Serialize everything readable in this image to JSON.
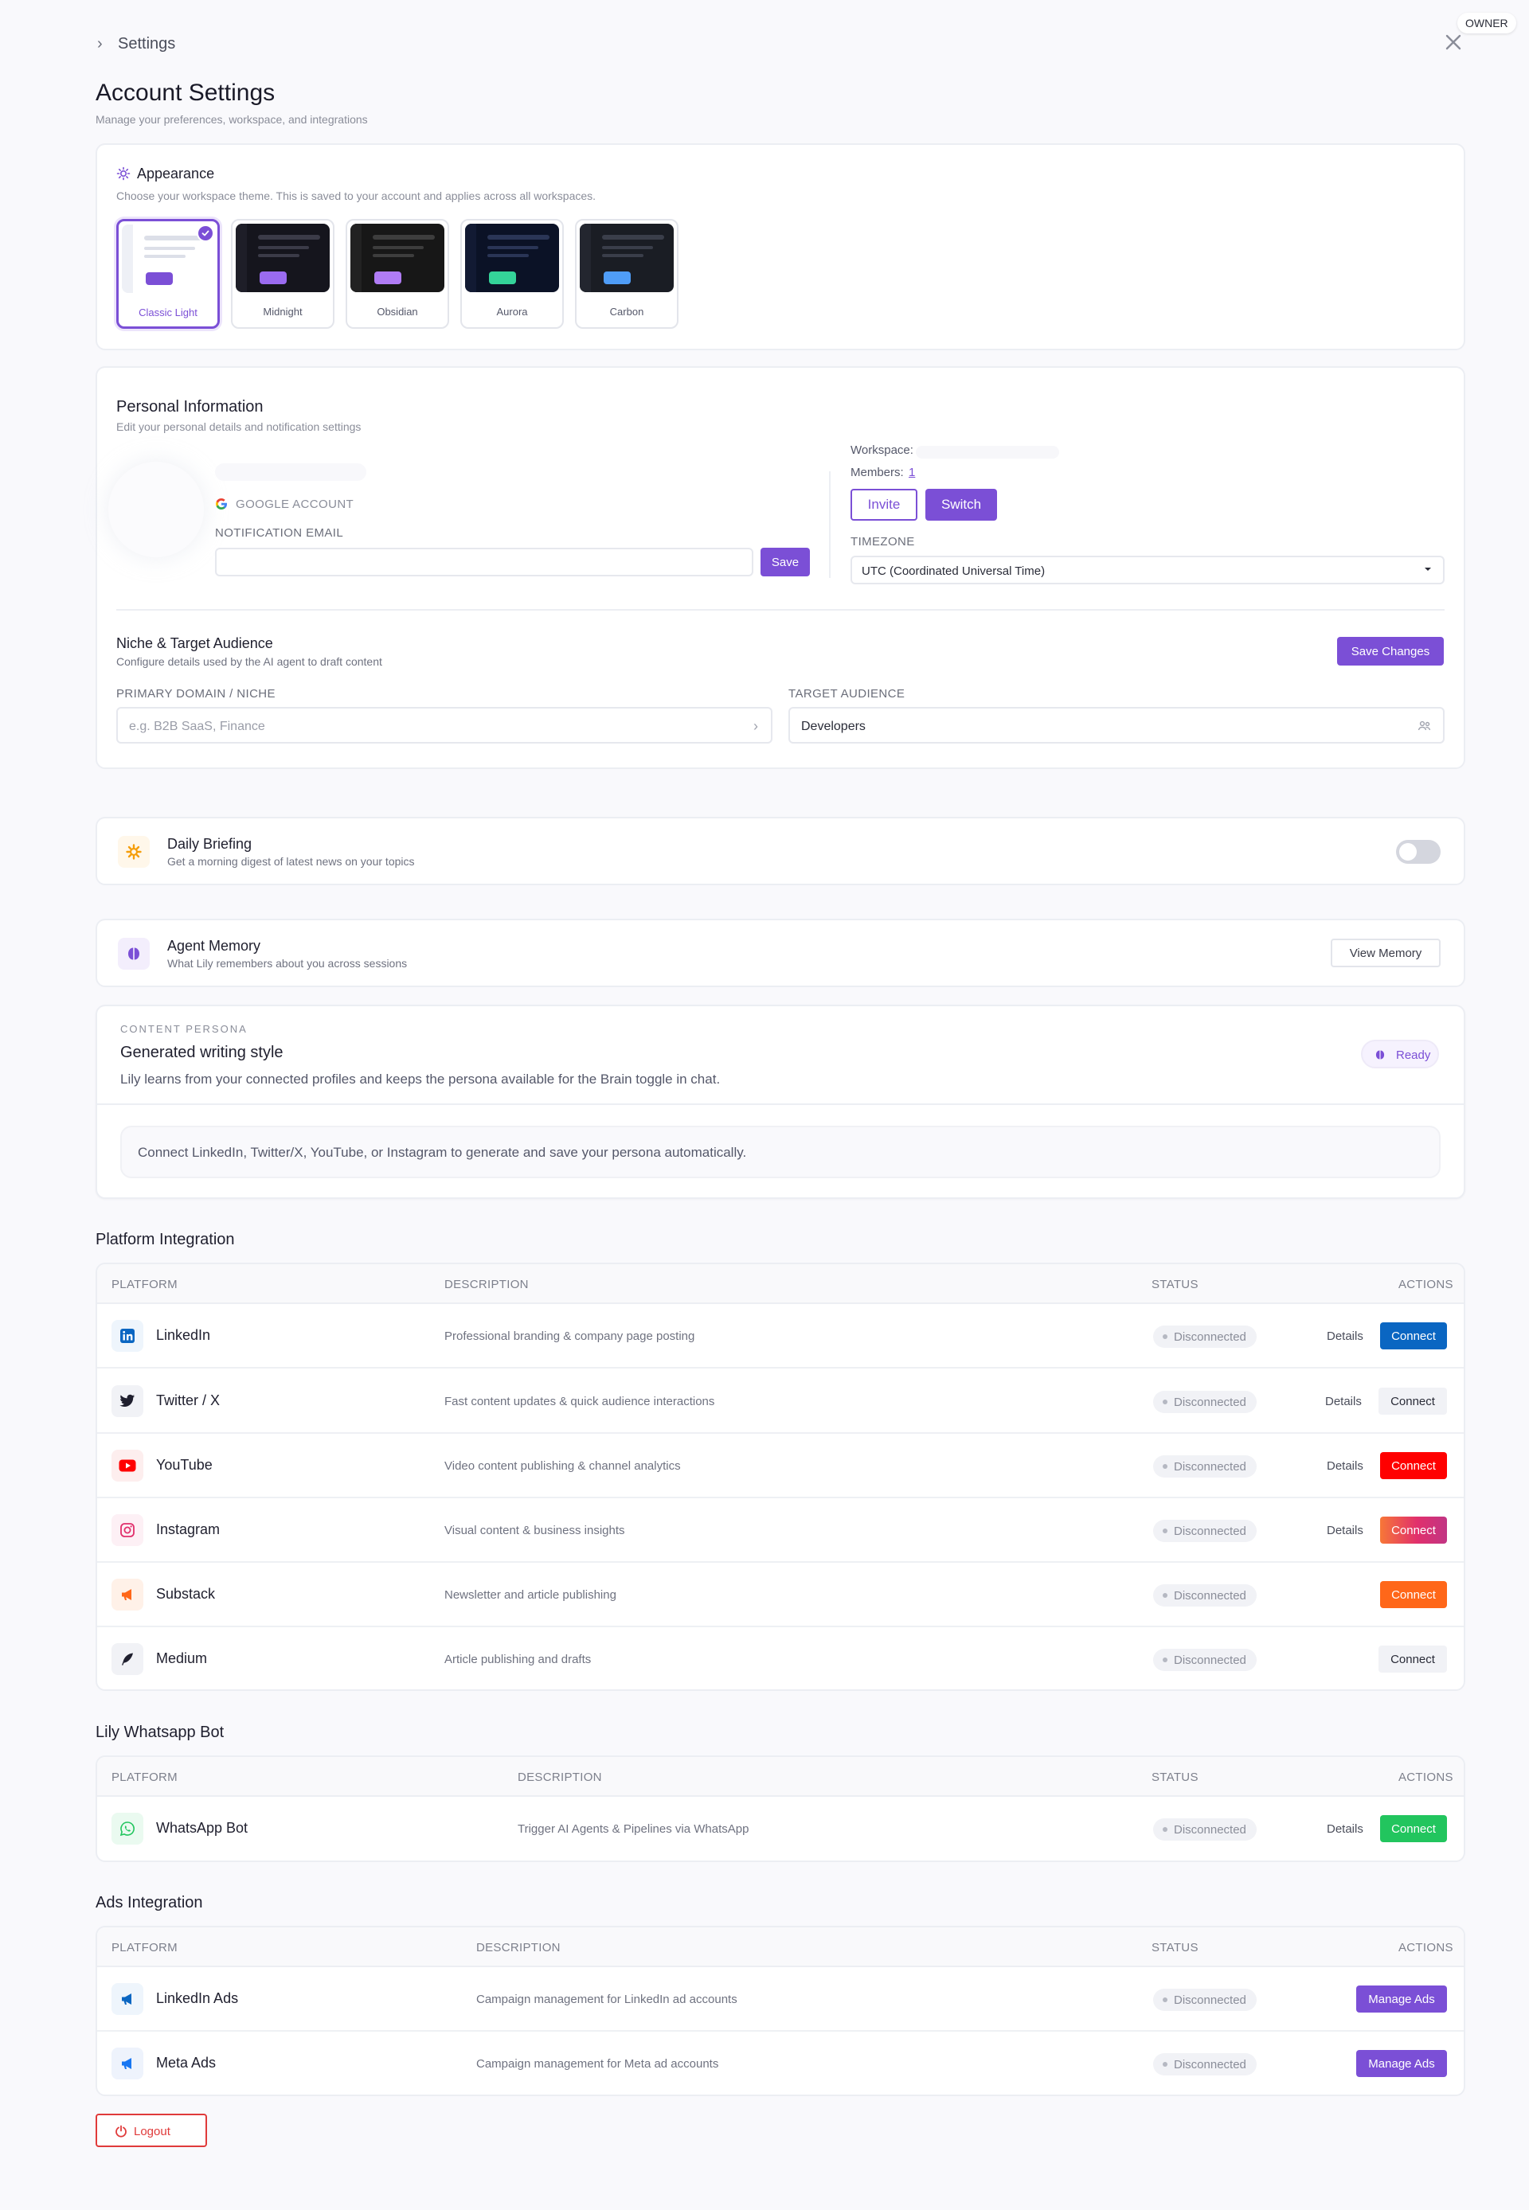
{
  "header": {
    "breadcrumb": "Settings",
    "role_badge": "OWNER",
    "title": "Account Settings",
    "subtitle": "Manage your preferences, workspace, and integrations"
  },
  "appearance": {
    "title": "Appearance",
    "description": "Choose your workspace theme. This is saved to your account and applies across all workspaces.",
    "selected": "Classic Light",
    "themes": [
      {
        "name": "Classic Light",
        "bg": "#ffffff",
        "sidebar": "#eef0f6",
        "line": "#dcdfe8",
        "chip": "#7b4fd6"
      },
      {
        "name": "Midnight",
        "bg": "#15151d",
        "sidebar": "#1e1e28",
        "line": "#3b3b48",
        "chip": "#9a6bf0"
      },
      {
        "name": "Obsidian",
        "bg": "#171717",
        "sidebar": "#222222",
        "line": "#3d3d3d",
        "chip": "#b07cf5"
      },
      {
        "name": "Aurora",
        "bg": "#0b1226",
        "sidebar": "#121a33",
        "line": "#2a3556",
        "chip": "#34d399"
      },
      {
        "name": "Carbon",
        "bg": "#1a1d24",
        "sidebar": "#23262f",
        "line": "#3a3e4a",
        "chip": "#4f9df7"
      }
    ]
  },
  "personal": {
    "title": "Personal Information",
    "subtitle": "Edit your personal details and notification settings",
    "google_account_label": "GOOGLE ACCOUNT",
    "notification_email_label": "NOTIFICATION EMAIL",
    "notification_email_value": "",
    "save_label": "Save",
    "workspace_label": "Workspace:",
    "members_label": "Members:",
    "members_count": "1",
    "invite_label": "Invite",
    "switch_label": "Switch",
    "timezone_label": "TIMEZONE",
    "timezone_value": "UTC (Coordinated Universal Time)"
  },
  "niche": {
    "title": "Niche & Target Audience",
    "subtitle": "Configure details used by the AI agent to draft content",
    "save_changes_label": "Save Changes",
    "primary_domain_label": "PRIMARY DOMAIN / NICHE",
    "primary_domain_placeholder": "e.g. B2B SaaS, Finance",
    "target_audience_label": "TARGET AUDIENCE",
    "target_audience_value": "Developers"
  },
  "daily_briefing": {
    "title": "Daily Briefing",
    "subtitle": "Get a morning digest of latest news on your topics",
    "enabled": false
  },
  "agent_memory": {
    "title": "Agent Memory",
    "subtitle": "What Lily remembers about you across sessions",
    "view_label": "View Memory"
  },
  "persona": {
    "eyebrow": "CONTENT PERSONA",
    "title": "Generated writing style",
    "description": "Lily learns from your connected profiles and keeps the persona available for the Brain toggle in chat.",
    "status": "Ready",
    "notice": "Connect LinkedIn, Twitter/X, YouTube, or Instagram to generate and save your persona automatically."
  },
  "platform_integration": {
    "title": "Platform Integration",
    "columns": [
      "PLATFORM",
      "DESCRIPTION",
      "STATUS",
      "ACTIONS"
    ],
    "rows": [
      {
        "name": "LinkedIn",
        "description": "Professional branding & company page posting",
        "status": "Disconnected",
        "details": "Details",
        "action": "Connect",
        "color": "#0a66c2"
      },
      {
        "name": "Twitter / X",
        "description": "Fast content updates & quick audience interactions",
        "status": "Disconnected",
        "details": "Details",
        "action": "Connect",
        "color": "#f1f2f6"
      },
      {
        "name": "YouTube",
        "description": "Video content publishing & channel analytics",
        "status": "Disconnected",
        "details": "Details",
        "action": "Connect",
        "color": "#ff0000"
      },
      {
        "name": "Instagram",
        "description": "Visual content & business insights",
        "status": "Disconnected",
        "details": "Details",
        "action": "Connect",
        "color": "#e1306c"
      },
      {
        "name": "Substack",
        "description": "Newsletter and article publishing",
        "status": "Disconnected",
        "details": "",
        "action": "Connect",
        "color": "#ff6719"
      },
      {
        "name": "Medium",
        "description": "Article publishing and drafts",
        "status": "Disconnected",
        "details": "",
        "action": "Connect",
        "color": "#f1f2f6"
      }
    ]
  },
  "whatsapp": {
    "title": "Lily Whatsapp Bot",
    "columns": [
      "PLATFORM",
      "DESCRIPTION",
      "STATUS",
      "ACTIONS"
    ],
    "rows": [
      {
        "name": "WhatsApp Bot",
        "description": "Trigger AI Agents & Pipelines via WhatsApp",
        "status": "Disconnected",
        "details": "Details",
        "action": "Connect",
        "color": "#22c55e"
      }
    ]
  },
  "ads_integration": {
    "title": "Ads Integration",
    "columns": [
      "PLATFORM",
      "DESCRIPTION",
      "STATUS",
      "ACTIONS"
    ],
    "rows": [
      {
        "name": "LinkedIn Ads",
        "description": "Campaign management for LinkedIn ad accounts",
        "status": "Disconnected",
        "action": "Manage Ads"
      },
      {
        "name": "Meta Ads",
        "description": "Campaign management for Meta ad accounts",
        "status": "Disconnected",
        "action": "Manage Ads"
      }
    ]
  },
  "logout_label": "Logout"
}
